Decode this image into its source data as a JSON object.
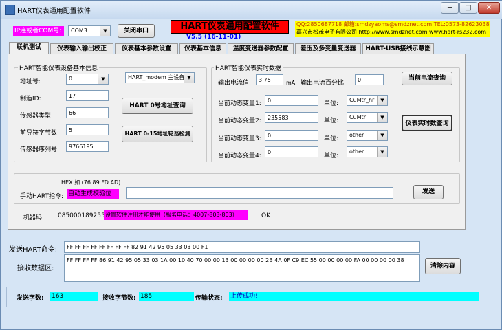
{
  "window": {
    "title": "HART仪表通用配置软件",
    "minimize_glyph": "─",
    "maximize_glyph": "□",
    "close_glyph": "✕"
  },
  "header": {
    "port_label": "IP连或者COM号:",
    "port_value": "COM3",
    "close_port_button": "关闭串口",
    "app_banner": "HART仪表通用配置软件",
    "version": "V5.5 (16-11-01)",
    "contact_line1": "QQ:2850687718  邮箱:smdzyaoms@smdznet.com TEL:0573-82623038",
    "contact_line2": "嘉兴市松茂电子有限公司 http://www.smdznet.com  www.hart-rs232.com"
  },
  "tabs": [
    {
      "label": "联机测试"
    },
    {
      "label": "仪表输入输出校正"
    },
    {
      "label": "仪表基本参数设置"
    },
    {
      "label": "仪表基本信息"
    },
    {
      "label": "温度变送器参数配置"
    },
    {
      "label": "差压及多变量变送器"
    },
    {
      "label": "HART-USB接线示意图"
    }
  ],
  "basic_info": {
    "group_title": "HART智能仪表设备基本信息",
    "addr_label": "地址号:",
    "addr_value": "0",
    "mfr_label": "制造ID:",
    "mfr_value": "17",
    "type_label": "传感器类型:",
    "type_value": "66",
    "preamble_label": "前导符字节数:",
    "preamble_value": "5",
    "serial_label": "传感器序列号:",
    "serial_value": "9766195",
    "master_mode": "HART_modem 主设备",
    "query0_button": "HART 0号地址查询",
    "poll_button": "HART 0-15地址轮巡检测"
  },
  "realtime": {
    "group_title": "HART智能仪表实时数据",
    "current_label": "输出电流值:",
    "current_value": "3.75",
    "current_unit": "mA",
    "percent_label": "输出电流百分比:",
    "percent_value": "0",
    "current_query_button": "当前电流查询",
    "realtime_query_button": "仪表实时数查询",
    "unit_label": "单位:",
    "vars": [
      {
        "label": "当前动态变量1:",
        "value": "0",
        "unit": "CuMtr_hr"
      },
      {
        "label": "当前动态变量2:",
        "value": "235583",
        "unit": "CuMtr"
      },
      {
        "label": "当前动态变量3:",
        "value": "0",
        "unit": "other"
      },
      {
        "label": "当前动态变量4:",
        "value": "0",
        "unit": "other"
      }
    ]
  },
  "manual": {
    "hex_hint": "HEX 如 (76 89 FD AD)",
    "label": "手动HART指令:",
    "auto_checksum": "自动生成校验位",
    "command_value": "",
    "send_button": "发送"
  },
  "machine": {
    "label": "机器码:",
    "code": "085000189255",
    "notice": "设置软件注册才能使用（服务电话：4007-803-803）",
    "status": "OK"
  },
  "io": {
    "send_label": "发送HART命令:",
    "send_value": "FF FF FF FF FF FF FF FF 82 91 42 95 05 33 03 00 F1",
    "recv_label": "接收数据区:",
    "recv_value": "FF FF FF FF 86 91 42 95 05 33 03 1A 00 10 40 70 00 00 13 00 00 00 00 2B 4A 0F C9 EC 55 00 00 00 00 FA 00 00 00 00 38",
    "clear_button": "清除内容"
  },
  "status": {
    "sent_label": "发送字数:",
    "sent_value": "163",
    "recv_label": "接收字节数:",
    "recv_value": "185",
    "trans_label": "传输状态:",
    "trans_value": "上传成功!"
  },
  "colors": {
    "banner_red": "#ff0000",
    "contact_yellow": "#ffff00",
    "highlight_cyan": "#00ffff",
    "highlight_magenta": "#ff00ff",
    "version_blue": "#0000ff"
  }
}
